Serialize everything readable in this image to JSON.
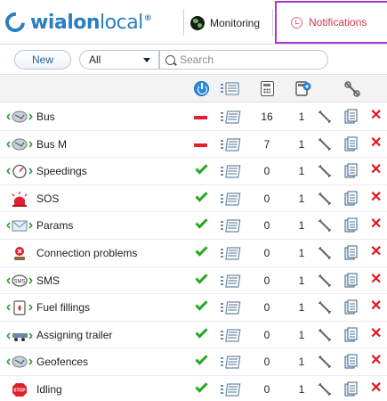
{
  "header": {
    "logo_text_bold": "wialon",
    "logo_text_light": "local",
    "logo_sup": "®",
    "tabs": [
      {
        "label": "Monitoring",
        "icon": "globe-icon"
      },
      {
        "label": "Notifications",
        "icon": "alarm-clock-icon",
        "active": true
      }
    ]
  },
  "toolbar": {
    "new_label": "New",
    "filter_value": "All",
    "search_placeholder": "Search"
  },
  "columns": {
    "icons": [
      "power-icon",
      "list-icon",
      "calculator-icon",
      "calculator-gear-icon",
      "wrench-icon"
    ]
  },
  "colors": {
    "accent": "#2a7fc0",
    "active_tab_border": "#a23bcf",
    "active_tab_text": "#d6344c",
    "enabled": "#26a81f",
    "disabled": "#e0202a",
    "delete": "#e0141e"
  },
  "rows": [
    {
      "name": "Bus",
      "icon": "geofence-icon",
      "state": "disabled",
      "count": "16",
      "count2": "1"
    },
    {
      "name": "Bus M",
      "icon": "geofence-icon",
      "state": "disabled",
      "count": "7",
      "count2": "1"
    },
    {
      "name": "Speedings",
      "icon": "speedometer-icon",
      "state": "enabled",
      "count": "0",
      "count2": "1"
    },
    {
      "name": "SOS",
      "icon": "alarm-light-icon",
      "state": "enabled",
      "count": "0",
      "count2": "1"
    },
    {
      "name": "Params",
      "icon": "envelope-icon",
      "state": "enabled",
      "count": "0",
      "count2": "1"
    },
    {
      "name": "Connection problems",
      "icon": "connection-icon",
      "state": "enabled",
      "count": "0",
      "count2": "1"
    },
    {
      "name": "SMS",
      "icon": "sms-icon",
      "state": "enabled",
      "count": "0",
      "count2": "1"
    },
    {
      "name": "Fuel fillings",
      "icon": "fuel-icon",
      "state": "enabled",
      "count": "0",
      "count2": "1"
    },
    {
      "name": "Assigning trailer",
      "icon": "trailer-icon",
      "state": "enabled",
      "count": "0",
      "count2": "1"
    },
    {
      "name": "Geofences",
      "icon": "geofence-icon",
      "state": "enabled",
      "count": "0",
      "count2": "1"
    },
    {
      "name": "Idling",
      "icon": "stop-sign-icon",
      "state": "enabled",
      "count": "0",
      "count2": "1"
    }
  ]
}
